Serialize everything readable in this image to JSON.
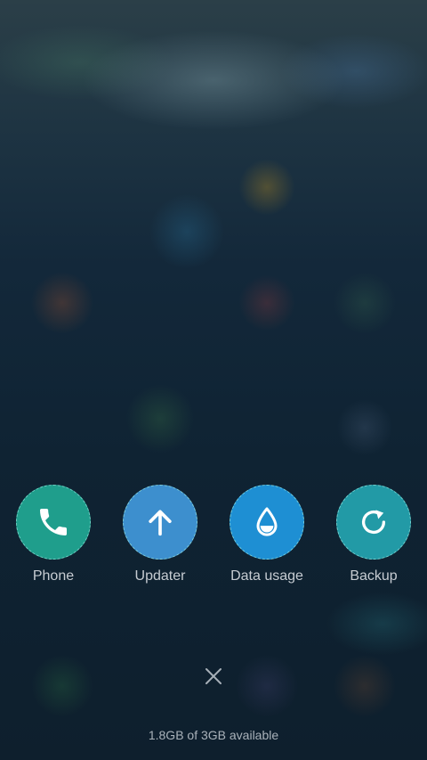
{
  "shortcuts": [
    {
      "label": "Phone",
      "icon": "phone-icon",
      "color": "#1f9e8c"
    },
    {
      "label": "Updater",
      "icon": "arrow-up-icon",
      "color": "#3d8fce"
    },
    {
      "label": "Data usage",
      "icon": "water-drop-icon",
      "color": "#1e8fd3"
    },
    {
      "label": "Backup",
      "icon": "refresh-icon",
      "color": "#229aa6"
    }
  ],
  "close": {
    "icon": "close-icon"
  },
  "memory": {
    "text": "1.8GB of 3GB available"
  }
}
